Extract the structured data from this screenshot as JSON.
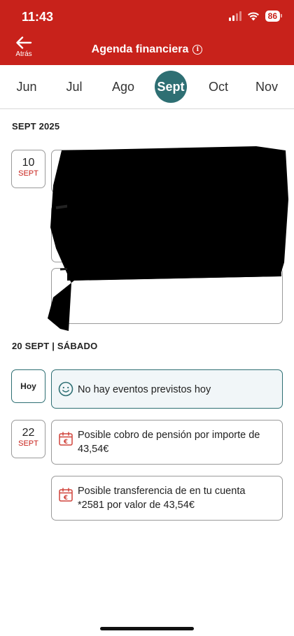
{
  "status_bar": {
    "time": "11:43",
    "battery": "86"
  },
  "nav": {
    "back_label": "Atrás",
    "title": "Agenda financiera"
  },
  "months": [
    {
      "label": "Jun",
      "active": false
    },
    {
      "label": "Jul",
      "active": false
    },
    {
      "label": "Ago",
      "active": false
    },
    {
      "label": "Sept",
      "active": true
    },
    {
      "label": "Oct",
      "active": false
    },
    {
      "label": "Nov",
      "active": false
    }
  ],
  "sections": [
    {
      "title": "SEPT 2025",
      "entries": [
        {
          "day": "10",
          "month": "SEPT"
        }
      ]
    },
    {
      "title": "20 SEPT | SÁBADO",
      "today": {
        "label": "Hoy",
        "message": "No hay eventos previstos hoy",
        "icon": "smiley-icon"
      },
      "entries": [
        {
          "day": "22",
          "month": "SEPT",
          "events": [
            {
              "text": "Posible cobro de pensión por importe de 43,54€",
              "icon": "calendar-euro-icon"
            },
            {
              "text": "Posible transferencia de  en tu cuenta *2581 por valor de 43,54€",
              "icon": "calendar-euro-icon"
            }
          ]
        }
      ]
    }
  ],
  "colors": {
    "brand_red": "#c8221b",
    "accent_teal": "#2e6f73"
  }
}
